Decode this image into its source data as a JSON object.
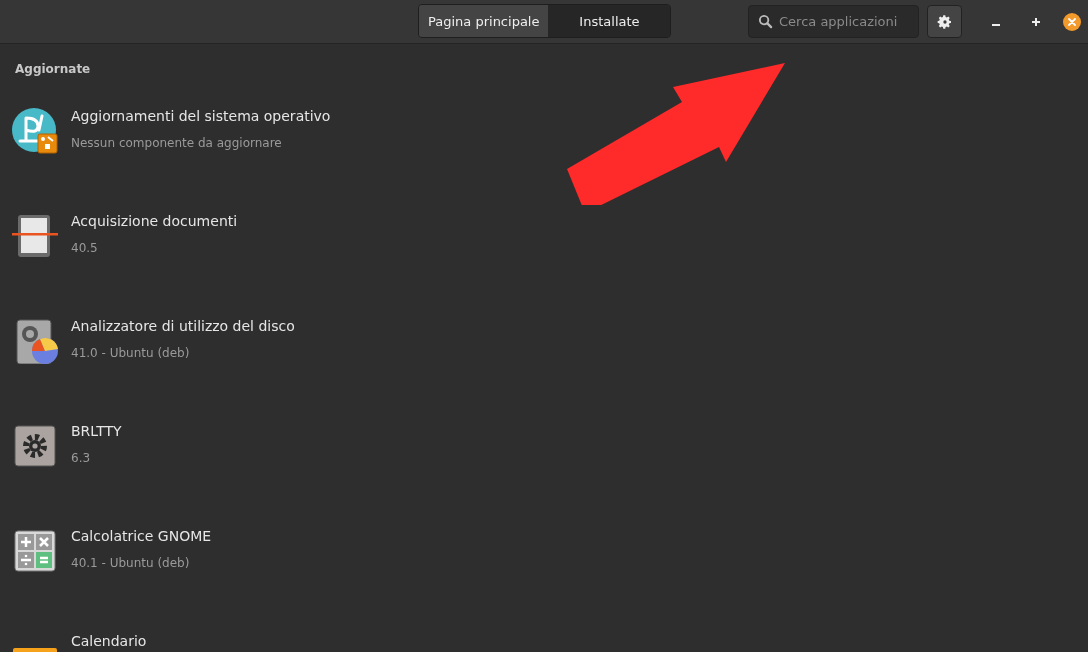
{
  "tabs": [
    {
      "label": "Pagina principale",
      "selected": false
    },
    {
      "label": "Installate",
      "selected": true
    }
  ],
  "search": {
    "placeholder": "Cerca applicazioni"
  },
  "section": {
    "title": "Aggiornate"
  },
  "apps": [
    {
      "name": "Aggiornamenti del sistema operativo",
      "detail": "Nessun componente da aggiornare"
    },
    {
      "name": "Acquisizione documenti",
      "detail": "40.5"
    },
    {
      "name": "Analizzatore di utilizzo del disco",
      "detail": "41.0 - Ubuntu (deb)"
    },
    {
      "name": "BRLTTY",
      "detail": "6.3"
    },
    {
      "name": "Calcolatrice GNOME",
      "detail": "40.1 - Ubuntu (deb)"
    },
    {
      "name": "Calendario"
    }
  ]
}
